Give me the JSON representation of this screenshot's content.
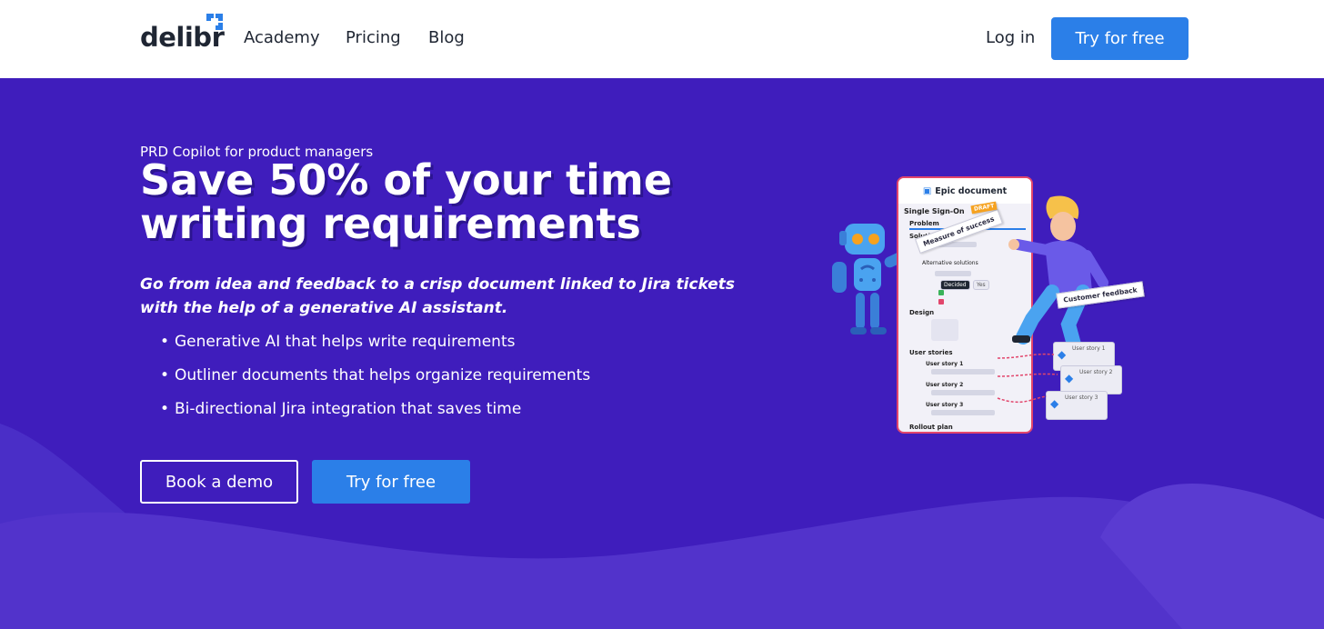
{
  "header": {
    "logo_text": "delibr",
    "nav": [
      "Academy",
      "Pricing",
      "Blog"
    ],
    "login": "Log in",
    "cta": "Try for free"
  },
  "hero": {
    "eyebrow": "PRD Copilot for product managers",
    "headline": "Save 50% of your time writing requirements",
    "subhead": "Go from idea and feedback to a crisp document linked to Jira tickets with the help of a generative AI assistant.",
    "bullets": [
      "Generative AI that helps write requirements",
      "Outliner documents that helps organize requirements",
      "Bi-directional Jira integration that saves time"
    ],
    "demo_button": "Book a demo",
    "try_button": "Try for free"
  },
  "illustration": {
    "doc_title": "Epic document",
    "doc_subtitle": "Single Sign-On",
    "sections": [
      "Problem",
      "Solution",
      "Design",
      "User stories",
      "Rollout plan"
    ],
    "measure_tag": "Measure of success",
    "draft_badge": "DRAFT",
    "customer_feedback": "Customer feedback",
    "alternative_solutions": "Alternative solutions",
    "decided": "Decided",
    "yes": "Yes",
    "user_stories": [
      "User story 1",
      "User story 2",
      "User story 3"
    ]
  },
  "colors": {
    "brand_purple": "#3f1dbc",
    "accent_blue": "#2b7fe8",
    "doc_border": "#e2466c"
  }
}
